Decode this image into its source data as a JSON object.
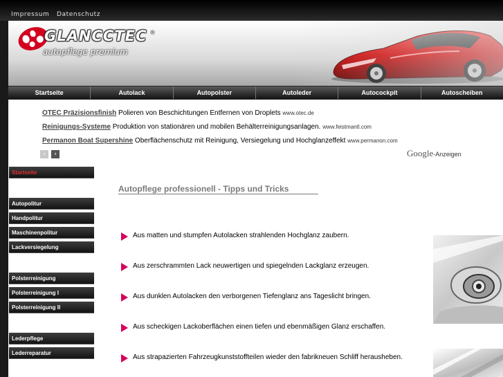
{
  "top_links": [
    "Impressum",
    "Datenschutz"
  ],
  "header": {
    "brand": "GLANCCTEC",
    "reg": "®",
    "tagline": "autopflege premium"
  },
  "nav": [
    "Startseite",
    "Autolack",
    "Autopolster",
    "Autoleder",
    "Autocockpit",
    "Autoscheiben"
  ],
  "ads": [
    {
      "title": "OTEC Präzisionsfinish",
      "text": " Polieren von Beschichtungen Entfernen von Droplets ",
      "url": "www.otec.de"
    },
    {
      "title": "Reinigungs-Systeme",
      "text": " Produktion von stationären und mobilen Behälterreinigungsanlagen. ",
      "url": "www.feistmantl.com"
    },
    {
      "title": "Permanon Boat Supershine",
      "text": " Oberflächenschutz mit Reinigung, Versiegelung und Hochglanzeffekt ",
      "url": "www.permanon.com"
    }
  ],
  "ad_nav": {
    "prev": "‹",
    "next": "›"
  },
  "google": {
    "brand": "Google",
    "suffix": "-Anzeigen"
  },
  "sidebar": [
    {
      "label": "Startseite",
      "active": true
    },
    {
      "label": "Autopolitur"
    },
    {
      "label": "Handpolitur"
    },
    {
      "label": "Maschinenpolitur"
    },
    {
      "label": "Lackversiegelung"
    },
    {
      "label": "Polsterreinigung"
    },
    {
      "label": "Polsterreinigung I"
    },
    {
      "label": "Polsterreinigung II"
    },
    {
      "label": "Lederpflege"
    },
    {
      "label": "Lederreparatur"
    }
  ],
  "main": {
    "title": "Autopflege professionell - Tipps und Tricks",
    "bullets": [
      "Aus matten und stumpfen Autolacken strahlenden Hochglanz zaubern.",
      "Aus zerschrammten Lack neuwertigen und spiegelnden Lackglanz erzeugen.",
      "Aus dunklen Autolacken den verborgenen Tiefenglanz ans Tageslicht bringen.",
      "Aus scheckigen Lackoberflächen einen tiefen und ebenmäßigen Glanz erschaffen.",
      "Aus strapazierten Fahrzeugkunststoffteilen wieder den fabrikneuen Schliff herausheben."
    ]
  },
  "colors": {
    "accent": "#d6005c",
    "active_nav": "#e03030",
    "brand_red": "#d3001f"
  }
}
